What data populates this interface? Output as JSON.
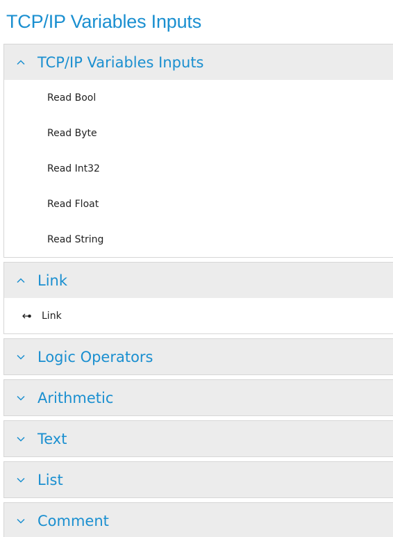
{
  "page_title": "TCP/IP Variables Inputs",
  "accent_color": "#1a8fd0",
  "header_background": "#ececec",
  "sections": [
    {
      "title": "TCP/IP Variables Inputs",
      "expanded": true,
      "items": [
        {
          "label": "Read Bool"
        },
        {
          "label": "Read Byte"
        },
        {
          "label": "Read Int32"
        },
        {
          "label": "Read Float"
        },
        {
          "label": "Read String"
        }
      ]
    },
    {
      "title": "Link",
      "expanded": true,
      "items": [
        {
          "label": "Link",
          "icon": "link-arrow-icon"
        }
      ]
    },
    {
      "title": "Logic Operators",
      "expanded": false
    },
    {
      "title": "Arithmetic",
      "expanded": false
    },
    {
      "title": "Text",
      "expanded": false
    },
    {
      "title": "List",
      "expanded": false
    },
    {
      "title": "Comment",
      "expanded": false
    }
  ]
}
